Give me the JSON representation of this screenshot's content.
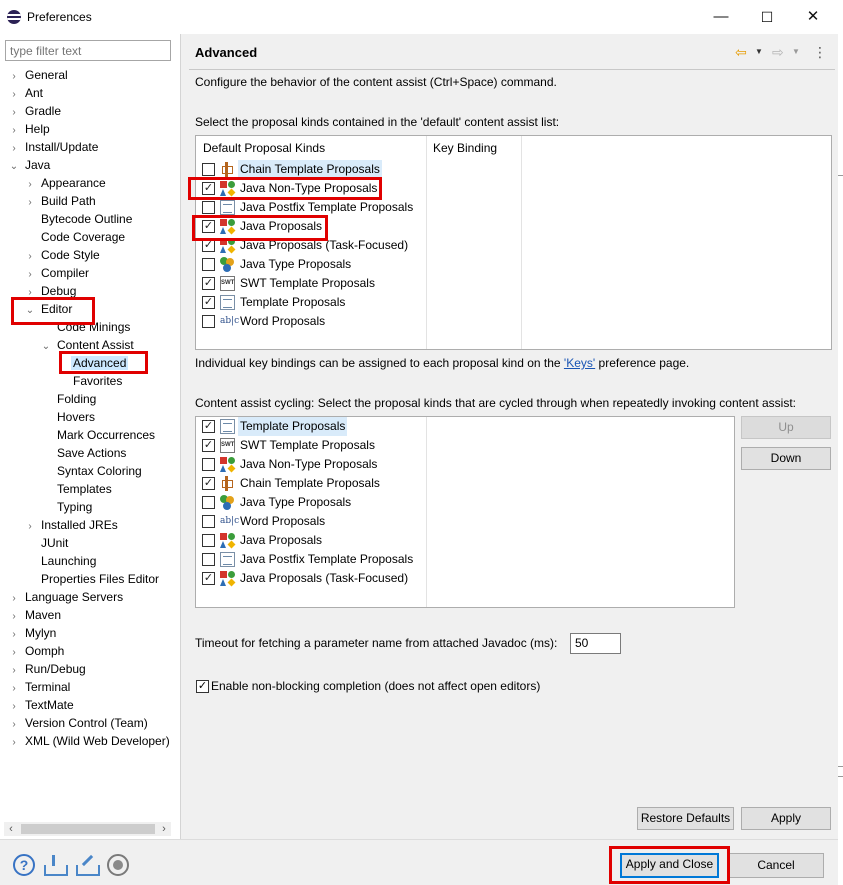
{
  "window": {
    "title": "Preferences",
    "minimize": "—",
    "maximize": "☐",
    "close": "✕"
  },
  "left": {
    "filter_placeholder": "type filter text",
    "tree": [
      {
        "label": "General",
        "arrow": "›",
        "depth": 0
      },
      {
        "label": "Ant",
        "arrow": "›",
        "depth": 0
      },
      {
        "label": "Gradle",
        "arrow": "›",
        "depth": 0
      },
      {
        "label": "Help",
        "arrow": "›",
        "depth": 0
      },
      {
        "label": "Install/Update",
        "arrow": "›",
        "depth": 0
      },
      {
        "label": "Java",
        "arrow": "⌄",
        "depth": 0
      },
      {
        "label": "Appearance",
        "arrow": "›",
        "depth": 1
      },
      {
        "label": "Build Path",
        "arrow": "›",
        "depth": 1
      },
      {
        "label": "Bytecode Outline",
        "arrow": "",
        "depth": 1
      },
      {
        "label": "Code Coverage",
        "arrow": "",
        "depth": 1
      },
      {
        "label": "Code Style",
        "arrow": "›",
        "depth": 1
      },
      {
        "label": "Compiler",
        "arrow": "›",
        "depth": 1
      },
      {
        "label": "Debug",
        "arrow": "›",
        "depth": 1
      },
      {
        "label": "Editor",
        "arrow": "⌄",
        "depth": 1
      },
      {
        "label": "Code Minings",
        "arrow": "",
        "depth": 2
      },
      {
        "label": "Content Assist",
        "arrow": "⌄",
        "depth": 2
      },
      {
        "label": "Advanced",
        "arrow": "",
        "depth": 3,
        "selected": true
      },
      {
        "label": "Favorites",
        "arrow": "",
        "depth": 3
      },
      {
        "label": "Folding",
        "arrow": "",
        "depth": 2
      },
      {
        "label": "Hovers",
        "arrow": "",
        "depth": 2
      },
      {
        "label": "Mark Occurrences",
        "arrow": "",
        "depth": 2
      },
      {
        "label": "Save Actions",
        "arrow": "",
        "depth": 2
      },
      {
        "label": "Syntax Coloring",
        "arrow": "",
        "depth": 2
      },
      {
        "label": "Templates",
        "arrow": "",
        "depth": 2
      },
      {
        "label": "Typing",
        "arrow": "",
        "depth": 2
      },
      {
        "label": "Installed JREs",
        "arrow": "›",
        "depth": 1
      },
      {
        "label": "JUnit",
        "arrow": "",
        "depth": 1
      },
      {
        "label": "Launching",
        "arrow": "",
        "depth": 1
      },
      {
        "label": "Properties Files Editor",
        "arrow": "",
        "depth": 1
      },
      {
        "label": "Language Servers",
        "arrow": "›",
        "depth": 0
      },
      {
        "label": "Maven",
        "arrow": "›",
        "depth": 0
      },
      {
        "label": "Mylyn",
        "arrow": "›",
        "depth": 0
      },
      {
        "label": "Oomph",
        "arrow": "›",
        "depth": 0
      },
      {
        "label": "Run/Debug",
        "arrow": "›",
        "depth": 0
      },
      {
        "label": "Terminal",
        "arrow": "›",
        "depth": 0
      },
      {
        "label": "TextMate",
        "arrow": "›",
        "depth": 0
      },
      {
        "label": "Version Control (Team)",
        "arrow": "›",
        "depth": 0
      },
      {
        "label": "XML (Wild Web Developer)",
        "arrow": "›",
        "depth": 0
      }
    ]
  },
  "page": {
    "title": "Advanced",
    "description": "Configure the behavior of the content assist (Ctrl+Space) command.",
    "default_list_label": "Select the proposal kinds contained in the 'default' content assist list:",
    "col_kinds": "Default Proposal Kinds",
    "col_binding": "Key Binding",
    "default_rows": [
      {
        "label": "Chain Template Proposals",
        "checked": false,
        "icon": "chain-icon"
      },
      {
        "label": "Java Non-Type Proposals",
        "checked": true,
        "icon": "java-shapes-icon"
      },
      {
        "label": "Java Postfix Template Proposals",
        "checked": false,
        "icon": "template-icon"
      },
      {
        "label": "Java Proposals",
        "checked": true,
        "icon": "java-shapes-icon"
      },
      {
        "label": "Java Proposals (Task-Focused)",
        "checked": true,
        "icon": "java-shapes-icon"
      },
      {
        "label": "Java Type Proposals",
        "checked": false,
        "icon": "java-type-icon"
      },
      {
        "label": "SWT Template Proposals",
        "checked": true,
        "icon": "swt-icon"
      },
      {
        "label": "Template Proposals",
        "checked": true,
        "icon": "template-icon"
      },
      {
        "label": "Word Proposals",
        "checked": false,
        "icon": "word-icon"
      }
    ],
    "keys_text_before": "Individual key bindings can be assigned to each proposal kind on the ",
    "keys_link": "'Keys'",
    "keys_text_after": " preference page.",
    "cycling_label": "Content assist cycling: Select the proposal kinds that are cycled through when repeatedly invoking content assist:",
    "cycling_rows": [
      {
        "label": "Template Proposals",
        "checked": true,
        "icon": "template-icon"
      },
      {
        "label": "SWT Template Proposals",
        "checked": true,
        "icon": "swt-icon"
      },
      {
        "label": "Java Non-Type Proposals",
        "checked": false,
        "icon": "java-shapes-icon"
      },
      {
        "label": "Chain Template Proposals",
        "checked": true,
        "icon": "chain-icon"
      },
      {
        "label": "Java Type Proposals",
        "checked": false,
        "icon": "java-type-icon"
      },
      {
        "label": "Word Proposals",
        "checked": false,
        "icon": "word-icon"
      },
      {
        "label": "Java Proposals",
        "checked": false,
        "icon": "java-shapes-icon"
      },
      {
        "label": "Java Postfix Template Proposals",
        "checked": false,
        "icon": "template-icon"
      },
      {
        "label": "Java Proposals (Task-Focused)",
        "checked": true,
        "icon": "java-shapes-icon"
      }
    ],
    "up_button": "Up",
    "down_button": "Down",
    "timeout_label": "Timeout for fetching a parameter name from attached Javadoc (ms):",
    "timeout_value": "50",
    "nonblocking_label": "Enable non-blocking completion (does not affect open editors)",
    "nonblocking_checked": true,
    "restore_defaults": "Restore Defaults",
    "apply": "Apply"
  },
  "bottom": {
    "apply_close": "Apply and Close",
    "cancel": "Cancel"
  },
  "colors": {
    "highlight_red": "#e00000",
    "selection_blue": "#cce8ff",
    "link_blue": "#1a55b4"
  }
}
